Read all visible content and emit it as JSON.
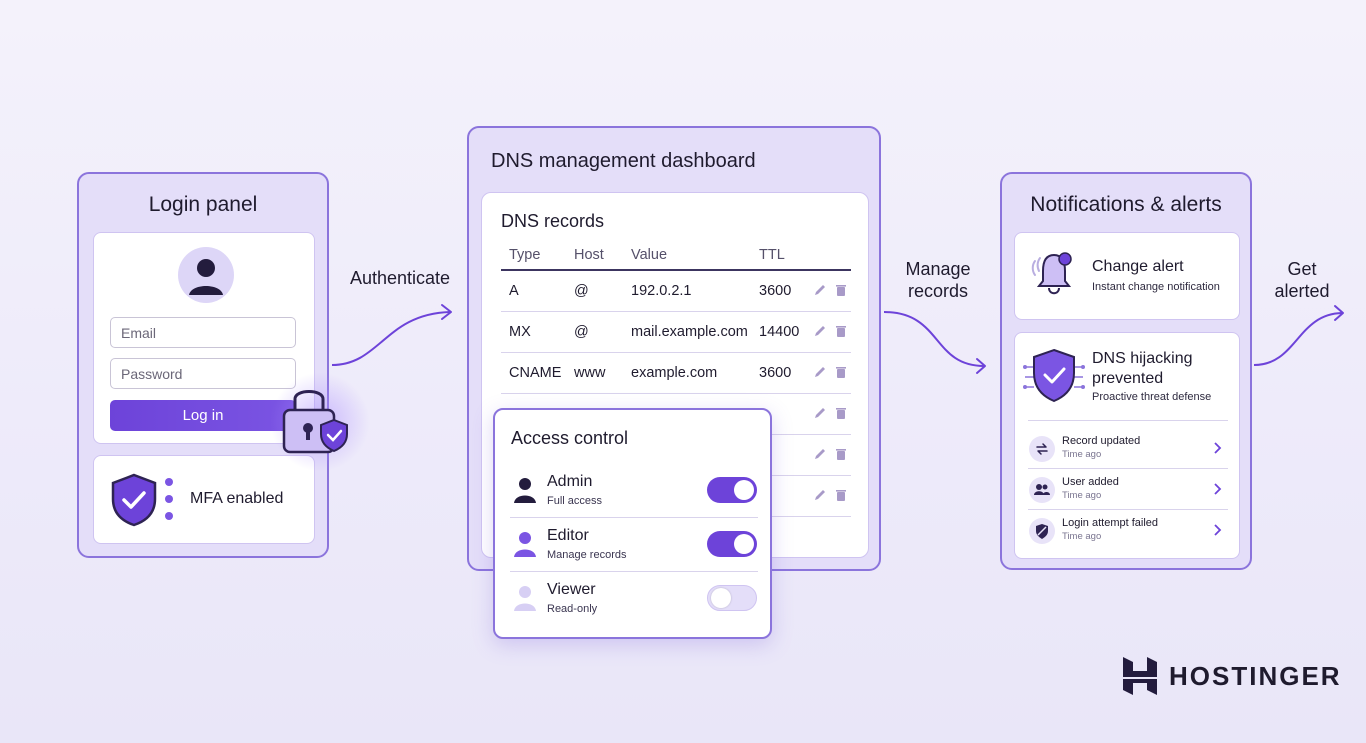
{
  "flow": {
    "authenticate": "Authenticate",
    "manage_records": "Manage\nrecords",
    "get_alerted": "Get\nalerted"
  },
  "login_panel": {
    "title": "Login panel",
    "email_placeholder": "Email",
    "password_placeholder": "Password",
    "login_button": "Log in",
    "mfa_label": "MFA enabled"
  },
  "dns_panel": {
    "title": "DNS management dashboard",
    "records_title": "DNS records",
    "columns": [
      "Type",
      "Host",
      "Value",
      "TTL"
    ],
    "rows": [
      {
        "type": "A",
        "host": "@",
        "value": "192.0.2.1",
        "ttl": "3600"
      },
      {
        "type": "MX",
        "host": "@",
        "value": "mail.example.com",
        "ttl": "14400"
      },
      {
        "type": "CNAME",
        "host": "www",
        "value": "example.com",
        "ttl": "3600"
      }
    ]
  },
  "access_control": {
    "title": "Access control",
    "roles": [
      {
        "name": "Admin",
        "desc": "Full access",
        "enabled": true
      },
      {
        "name": "Editor",
        "desc": "Manage records",
        "enabled": true
      },
      {
        "name": "Viewer",
        "desc": "Read-only",
        "enabled": false
      }
    ]
  },
  "notifications": {
    "title": "Notifications & alerts",
    "change_alert": {
      "title": "Change alert",
      "desc": "Instant change notification"
    },
    "hijack": {
      "title": "DNS hijacking\nprevented",
      "desc": "Proactive threat defense"
    },
    "items": [
      {
        "title": "Record updated",
        "time": "Time ago",
        "icon": "sync-icon"
      },
      {
        "title": "User added",
        "time": "Time ago",
        "icon": "users-icon"
      },
      {
        "title": "Login attempt failed",
        "time": "Time ago",
        "icon": "shield-blocked-icon"
      }
    ]
  },
  "brand": {
    "name": "HOSTINGER"
  },
  "colors": {
    "accent": "#6d43d9",
    "panel": "#e4def9",
    "border": "#8b74dc"
  }
}
